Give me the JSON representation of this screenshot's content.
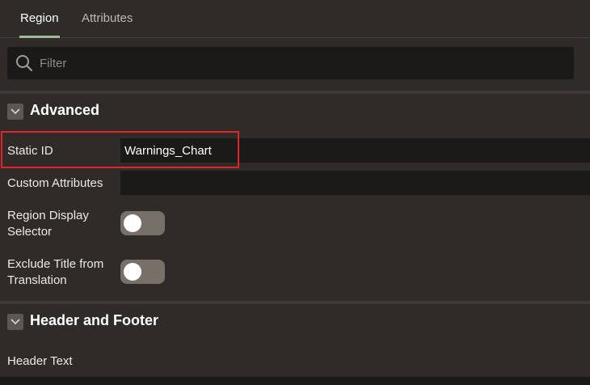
{
  "tabs": [
    {
      "label": "Region",
      "active": true
    },
    {
      "label": "Attributes",
      "active": false
    }
  ],
  "filter": {
    "placeholder": "Filter",
    "value": ""
  },
  "sections": {
    "advanced": {
      "title": "Advanced",
      "static_id": {
        "label": "Static ID",
        "value": "Warnings_Chart"
      },
      "custom_attributes": {
        "label": "Custom Attributes",
        "value": ""
      },
      "region_display_selector": {
        "label_line1": "Region Display",
        "label_line2": "Selector",
        "on": false
      },
      "exclude_title": {
        "label_line1": "Exclude Title from",
        "label_line2": "Translation",
        "on": false
      }
    },
    "header_footer": {
      "title": "Header and Footer",
      "header_text": {
        "label": "Header Text",
        "value": ""
      }
    }
  },
  "colors": {
    "background": "#2e2b28",
    "field": "#1c1a18",
    "tab_indicator": "#9fb99a",
    "highlight": "#e0252b",
    "toggle_off": "#777069"
  }
}
